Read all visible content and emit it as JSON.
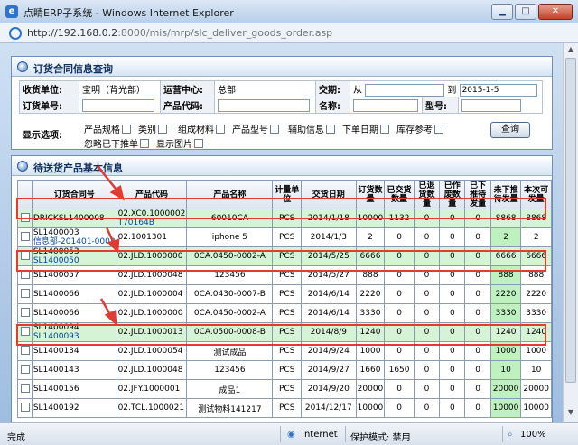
{
  "window": {
    "title": "点睛ERP子系统 - Windows Internet Explorer",
    "url_host": "http://192.168.0.2",
    "url_path": ":8000/mis/mrp/slc_deliver_goods_order.asp"
  },
  "query_panel": {
    "title": "订货合同信息查询",
    "receiver_label": "收货单位:",
    "receiver_value": "宝明（背光部）",
    "ops_center_label": "运营中心:",
    "ops_center_value": "总部",
    "delivery_date_label": "交期:",
    "from_label": "从",
    "to_label": "到",
    "date_to_value": "2015-1-5",
    "order_no_label": "订货单号:",
    "product_code_label": "产品代码:",
    "name_label": "名称:",
    "model_label": "型号:",
    "options_label": "显示选项:",
    "options": [
      "产品规格",
      "类别",
      "组成材料",
      "产品型号",
      "辅助信息",
      "下单日期",
      "库存参考",
      "忽略已下推单",
      "显示图片"
    ],
    "query_button": "查询"
  },
  "result_panel": {
    "title": "待送货产品基本信息",
    "columns": [
      "订货合同号",
      "产品代码",
      "产品名称",
      "计量单位",
      "交货日期",
      "订货数量",
      "已交货数量",
      "已退货数量",
      "已作废数量",
      "已下推待发量",
      "未下推待发量",
      "本次可发量"
    ],
    "rows": [
      {
        "contract": "DRICKSL1400008",
        "contract_sub": "",
        "code": "02.XC0.1000002",
        "code_sub": "T70164B",
        "name": "60010CA",
        "unit": "PCS",
        "date": "2014/1/18",
        "qty": "10000",
        "delivered": "1132",
        "returned": "0",
        "voided": "0",
        "pushed": "0",
        "unpushed": "8868",
        "available": "8868",
        "highlight": true
      },
      {
        "contract": "SL1400003",
        "contract_sub": "信息部-201401-0003",
        "code": "02.1001301",
        "code_sub": "",
        "name": "iphone 5",
        "unit": "PCS",
        "date": "2014/1/3",
        "qty": "2",
        "delivered": "0",
        "returned": "0",
        "voided": "0",
        "pushed": "0",
        "unpushed": "2",
        "available": "2",
        "highlight": false
      },
      {
        "contract": "SL1400053",
        "contract_sub": "SL1400050",
        "code": "02.JLD.1000000",
        "code_sub": "",
        "name": "0CA.0450-0002-A",
        "unit": "PCS",
        "date": "2014/5/25",
        "qty": "6666",
        "delivered": "0",
        "returned": "0",
        "voided": "0",
        "pushed": "0",
        "unpushed": "6666",
        "available": "6666",
        "highlight": true
      },
      {
        "contract": "SL1400057",
        "contract_sub": "",
        "code": "02.JLD.1000048",
        "code_sub": "",
        "name": "123456",
        "unit": "PCS",
        "date": "2014/5/27",
        "qty": "888",
        "delivered": "0",
        "returned": "0",
        "voided": "0",
        "pushed": "0",
        "unpushed": "888",
        "available": "888",
        "highlight": false
      },
      {
        "contract": "SL1400066",
        "contract_sub": "",
        "code": "02.JLD.1000004",
        "code_sub": "",
        "name": "0CA.0430-0007-B",
        "unit": "PCS",
        "date": "2014/6/14",
        "qty": "2220",
        "delivered": "0",
        "returned": "0",
        "voided": "0",
        "pushed": "0",
        "unpushed": "2220",
        "available": "2220",
        "highlight": false
      },
      {
        "contract": "SL1400066",
        "contract_sub": "",
        "code": "02.JLD.1000000",
        "code_sub": "",
        "name": "0CA.0450-0002-A",
        "unit": "PCS",
        "date": "2014/6/14",
        "qty": "3330",
        "delivered": "0",
        "returned": "0",
        "voided": "0",
        "pushed": "0",
        "unpushed": "3330",
        "available": "3330",
        "highlight": false
      },
      {
        "contract": "SL1400094",
        "contract_sub": "SL1400093",
        "code": "02.JLD.1000013",
        "code_sub": "",
        "name": "0CA.0500-0008-B",
        "unit": "PCS",
        "date": "2014/8/9",
        "qty": "1240",
        "delivered": "0",
        "returned": "0",
        "voided": "0",
        "pushed": "0",
        "unpushed": "1240",
        "available": "1240",
        "highlight": true
      },
      {
        "contract": "SL1400134",
        "contract_sub": "",
        "code": "02.JLD.1000054",
        "code_sub": "",
        "name": "测试成品",
        "unit": "PCS",
        "date": "2014/9/24",
        "qty": "1000",
        "delivered": "0",
        "returned": "0",
        "voided": "0",
        "pushed": "0",
        "unpushed": "1000",
        "available": "1000",
        "highlight": false
      },
      {
        "contract": "SL1400143",
        "contract_sub": "",
        "code": "02.JLD.1000048",
        "code_sub": "",
        "name": "123456",
        "unit": "PCS",
        "date": "2014/9/27",
        "qty": "1660",
        "delivered": "1650",
        "returned": "0",
        "voided": "0",
        "pushed": "0",
        "unpushed": "10",
        "available": "10",
        "highlight": false
      },
      {
        "contract": "SL1400156",
        "contract_sub": "",
        "code": "02.JFY.1000001",
        "code_sub": "",
        "name": "成品1",
        "unit": "PCS",
        "date": "2014/9/20",
        "qty": "20000",
        "delivered": "0",
        "returned": "0",
        "voided": "0",
        "pushed": "0",
        "unpushed": "20000",
        "available": "20000",
        "highlight": false
      },
      {
        "contract": "SL1400192",
        "contract_sub": "",
        "code": "02.TCL.1000021",
        "code_sub": "",
        "name": "测试物料141217",
        "unit": "PCS",
        "date": "2014/12/17",
        "qty": "10000",
        "delivered": "0",
        "returned": "0",
        "voided": "0",
        "pushed": "0",
        "unpushed": "10000",
        "available": "10000",
        "highlight": false
      }
    ]
  },
  "status_bar": {
    "status": "完成",
    "zone": "Internet",
    "protected_mode": "保护模式: 禁用",
    "zoom": "100%"
  },
  "colors": {
    "highlight_row": "#d5f3d5",
    "green_cell": "#bff0bf",
    "annotation_red": "#e03c31"
  }
}
